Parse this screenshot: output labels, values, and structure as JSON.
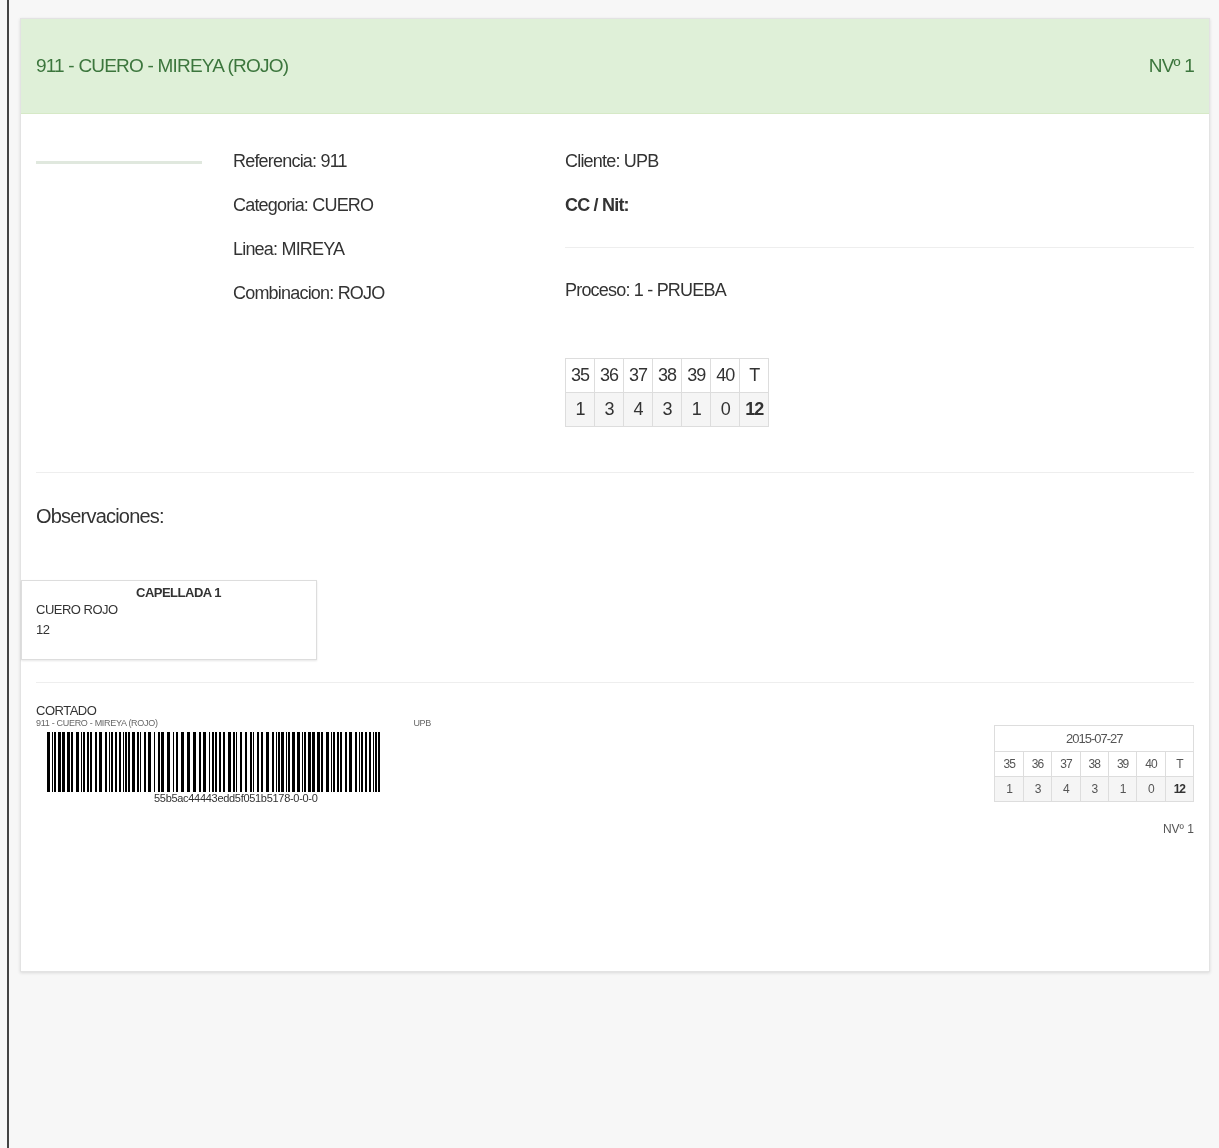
{
  "header": {
    "title": "911 - CUERO - MIREYA (ROJO)",
    "number": "NVº 1"
  },
  "details": [
    {
      "label": "Referencia:",
      "value": "911"
    },
    {
      "label": "Categoria:",
      "value": "CUERO"
    },
    {
      "label": "Linea:",
      "value": "MIREYA"
    },
    {
      "label": "Combinacion:",
      "value": "ROJO"
    }
  ],
  "client": [
    {
      "label": "Cliente:",
      "value": "UPB",
      "emphasis": false
    },
    {
      "label": "CC / Nit:",
      "emphasis": true
    }
  ],
  "process": "Proceso: 1 - PRUEBA",
  "sizes": {
    "headers": [
      "35",
      "36",
      "37",
      "38",
      "39",
      "40",
      "T"
    ],
    "values": [
      "1",
      "3",
      "4",
      "3",
      "1",
      "0",
      "12"
    ]
  },
  "observations_label": "Observaciones:",
  "pieces": [
    {
      "title": "CAPELLADA 1",
      "material": "CUERO ROJO",
      "quantity": "12"
    }
  ],
  "label": {
    "stage": "CORTADO",
    "title": "911 - CUERO - MIREYA (ROJO)",
    "client": "UPB",
    "barcode": "55b5ac44443edd5f051b5178-0-0-0",
    "date": "2015-07-27",
    "sizes": {
      "headers": [
        "35",
        "36",
        "37",
        "38",
        "39",
        "40",
        "T"
      ],
      "values": [
        "1",
        "3",
        "4",
        "3",
        "1",
        "0",
        "12"
      ]
    },
    "number": "NVº 1"
  }
}
